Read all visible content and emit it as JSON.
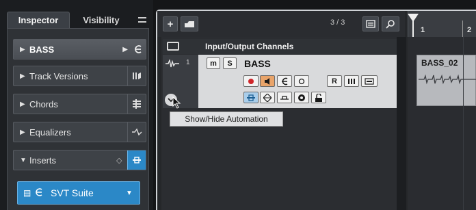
{
  "inspector": {
    "tabs": [
      {
        "label": "Inspector"
      },
      {
        "label": "Visibility"
      }
    ],
    "menu_icon": "hamburger-icon",
    "track_name": "BASS",
    "sections": [
      {
        "label": "Track Versions",
        "icon": "versions-icon"
      },
      {
        "label": "Chords",
        "icon": "chords-icon"
      },
      {
        "label": "Equalizers",
        "icon": "equalizer-icon"
      },
      {
        "label": "Inserts",
        "icon": "inserts-icon"
      }
    ],
    "insert_plugin": "SVT Suite"
  },
  "project": {
    "add_track_label": "+",
    "track_count": "3 / 3",
    "folder_track": "Input/Output Channels",
    "track": {
      "number": "1",
      "name": "BASS",
      "mute_label": "m",
      "solo_label": "S",
      "read_label": "R"
    },
    "ruler": {
      "bars": [
        "1",
        "2"
      ]
    },
    "event_name": "BASS_02",
    "tooltip": "Show/Hide Automation"
  }
}
